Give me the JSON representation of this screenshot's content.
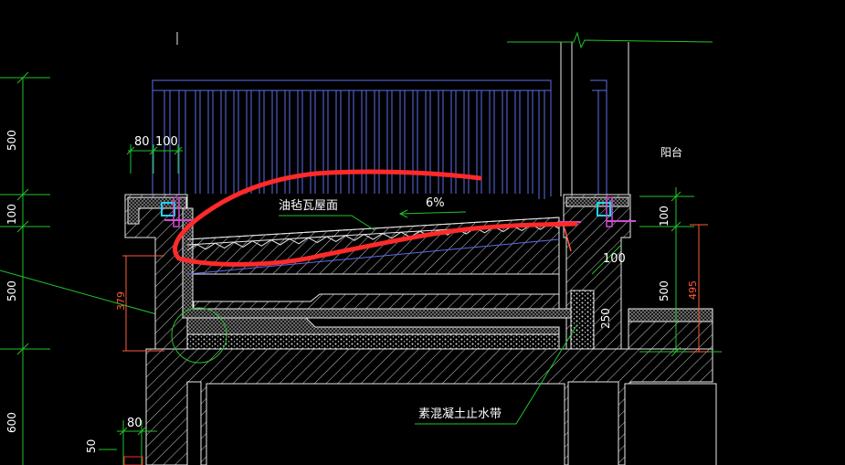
{
  "labels": {
    "roof_title": "油毡瓦屋面",
    "slope": "6%",
    "balcony": "阳台",
    "waterstop": "素混凝土止水带"
  },
  "dimensions": {
    "d80_top": "80",
    "d100_top": "100",
    "left_500_top": "500",
    "left_100": "100",
    "left_500_mid": "500",
    "left_600": "600",
    "left_379": "379",
    "left_80_bottom": "80",
    "left_50": "50",
    "right_100_a": "100",
    "right_100_b": "100",
    "right_500": "500",
    "right_495": "495",
    "d250": "250"
  },
  "colors": {
    "background": "#000000",
    "dimension_green": "#22c32a",
    "structure_white": "#e8e8e8",
    "railing_blue": "#5b6ee8",
    "markup_red": "#ff2a2a",
    "accent_orange": "#ff5a3c",
    "magenta": "#d24bd2",
    "cyan": "#22d3ee"
  }
}
